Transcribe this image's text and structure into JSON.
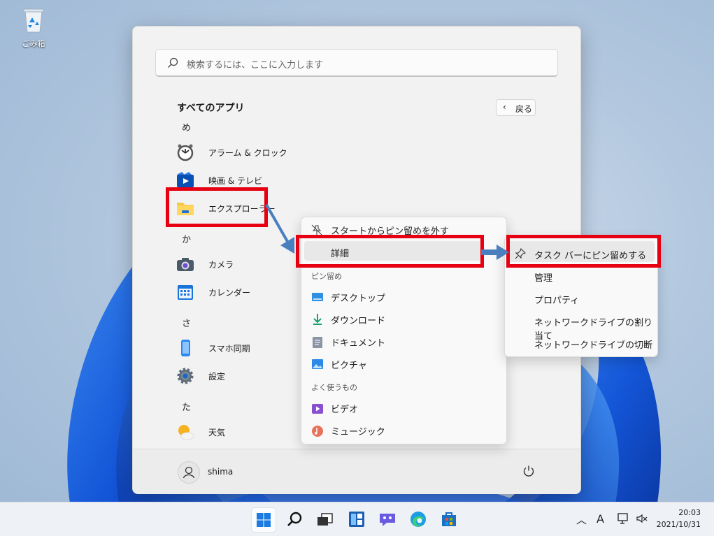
{
  "desktop": {
    "recycle_bin_label": "ごみ箱",
    "recycle_icon": "recycle-bin-icon"
  },
  "start_menu": {
    "search_placeholder": "検索するには、ここに入力します",
    "all_apps_title": "すべてのアプリ",
    "back_label": "戻る",
    "letters": [
      "め",
      "か",
      "さ",
      "た"
    ],
    "apps": [
      {
        "name": "アラーム & クロック",
        "icon": "alarm-clock-icon"
      },
      {
        "name": "映画 & テレビ",
        "icon": "movies-tv-icon"
      },
      {
        "name": "エクスプローラー",
        "icon": "file-explorer-icon"
      },
      {
        "name": "カメラ",
        "icon": "camera-icon"
      },
      {
        "name": "カレンダー",
        "icon": "calendar-icon"
      },
      {
        "name": "スマホ同期",
        "icon": "phone-link-icon"
      },
      {
        "name": "設定",
        "icon": "settings-icon"
      },
      {
        "name": "天気",
        "icon": "weather-icon"
      }
    ],
    "user_name": "shima"
  },
  "context_menu": {
    "unpin": "スタートからピン留めを外す",
    "more": "詳細",
    "pinned_header": "ピン留め",
    "pinned": [
      "デスクトップ",
      "ダウンロード",
      "ドキュメント",
      "ピクチャ"
    ],
    "frequent_header": "よく使うもの",
    "frequent": [
      "ビデオ",
      "ミュージック"
    ]
  },
  "submenu": {
    "items": [
      "タスク バーにピン留めする",
      "管理",
      "プロパティ",
      "ネットワークドライブの割り当て",
      "ネットワークドライブの切断"
    ]
  },
  "taskbar": {
    "time": "20:03",
    "date": "2021/10/31",
    "ime_indicator": "A"
  },
  "colors": {
    "highlight_red": "#e60012",
    "arrow_blue": "#4a7fbf",
    "accent": "#0067c0"
  }
}
